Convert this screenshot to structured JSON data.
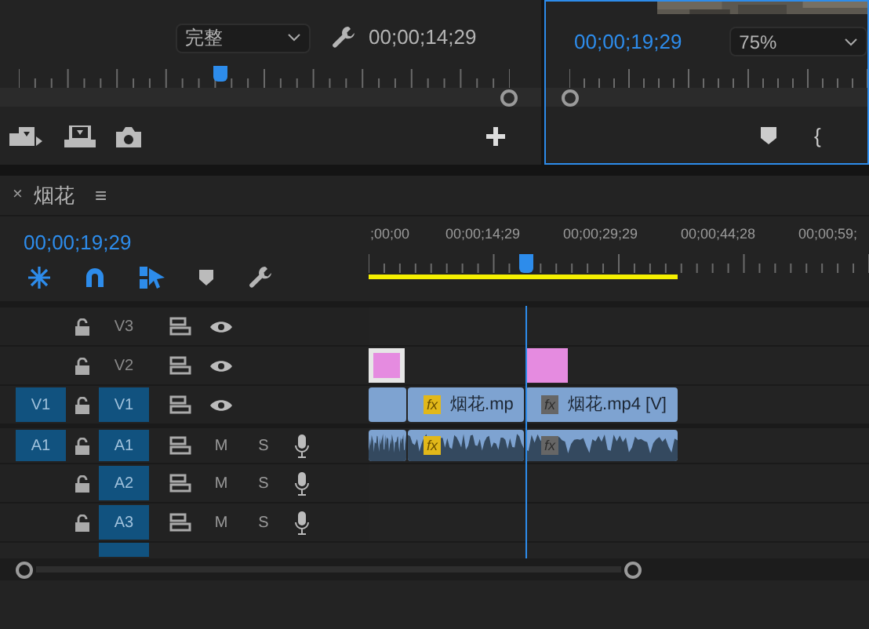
{
  "source_monitor": {
    "quality_dropdown": "完整",
    "timecode": "00;00;14;29",
    "playhead": {
      "level": 0.41
    }
  },
  "program_monitor": {
    "timecode": "00;00;19;29",
    "zoom_dropdown": "75%",
    "bracket_button": "{"
  },
  "timeline": {
    "tab_close": "×",
    "tab_title": "烟花",
    "tab_menu": "≡",
    "timecode": "00;00;19;29",
    "ruler_labels": [
      ";00;00",
      "00;00;14;29",
      "00;00;29;29",
      "00;00;44;28",
      "00;00;59;"
    ],
    "tracks": [
      {
        "name": "V3",
        "kind": "video",
        "targeted": false
      },
      {
        "name": "V2",
        "kind": "video",
        "targeted": false,
        "clips": [
          {
            "kind": "graphic",
            "selected": true
          },
          {
            "kind": "graphic",
            "selected": false
          }
        ]
      },
      {
        "name": "V1",
        "kind": "video",
        "targeted": true,
        "source_patch": "V1",
        "clips": [
          {
            "kind": "video"
          },
          {
            "kind": "video",
            "label": "烟花.mp",
            "fx": "fx",
            "fx_active": true
          },
          {
            "kind": "video",
            "label": "烟花.mp4 [V]",
            "fx": "fx",
            "fx_active": false
          }
        ]
      },
      {
        "name": "A1",
        "kind": "audio",
        "targeted": true,
        "source_patch": "A1",
        "mute": "M",
        "solo": "S",
        "clips": [
          {
            "kind": "audio"
          },
          {
            "kind": "audio",
            "fx": "fx",
            "fx_active": true
          },
          {
            "kind": "audio",
            "fx": "fx",
            "fx_active": false
          }
        ]
      },
      {
        "name": "A2",
        "kind": "audio",
        "targeted": true,
        "mute": "M",
        "solo": "S"
      },
      {
        "name": "A3",
        "kind": "audio",
        "targeted": true,
        "mute": "M",
        "solo": "S"
      }
    ]
  }
}
